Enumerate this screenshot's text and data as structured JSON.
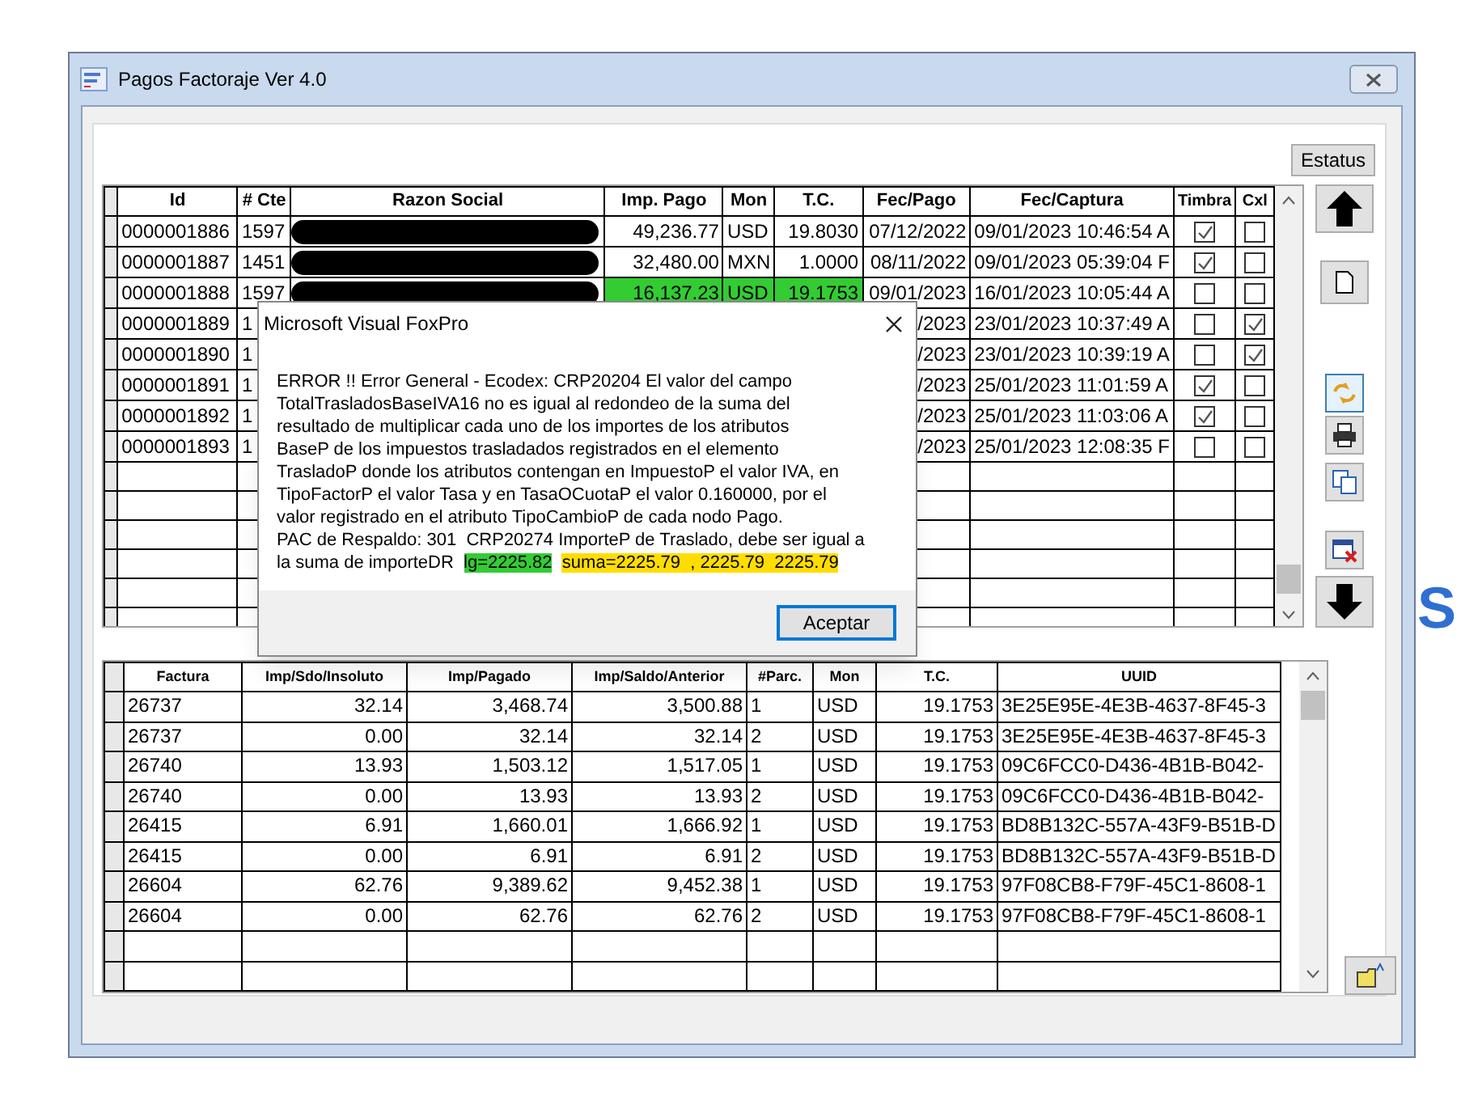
{
  "window": {
    "title": "Pagos Factoraje Ver 4.0"
  },
  "estatus_button": "Estatus",
  "payments": {
    "columns": [
      "Id",
      "# Cte",
      "Razon Social",
      "Imp. Pago",
      "Mon",
      "T.C.",
      "Fec/Pago",
      "Fec/Captura",
      "Timbra",
      "Cxl"
    ],
    "rows": [
      {
        "id": "0000001886",
        "cte": "1597",
        "imp_pago": "49,236.77",
        "mon": "USD",
        "tc": "19.8030",
        "fec_pago": "07/12/2022",
        "fec_captura": "09/01/2023 10:46:54 A",
        "timbra": true,
        "cxl": false,
        "highlighted": false,
        "redacted": true
      },
      {
        "id": "0000001887",
        "cte": "1451",
        "imp_pago": "32,480.00",
        "mon": "MXN",
        "tc": "1.0000",
        "fec_pago": "08/11/2022",
        "fec_captura": "09/01/2023 05:39:04 F",
        "timbra": true,
        "cxl": false,
        "highlighted": false,
        "redacted": true
      },
      {
        "id": "0000001888",
        "cte": "1597",
        "imp_pago": "16,137.23",
        "mon": "USD",
        "tc": "19.1753",
        "fec_pago": "09/01/2023",
        "fec_captura": "16/01/2023 10:05:44 A",
        "timbra": false,
        "cxl": false,
        "highlighted": true,
        "redacted": true
      },
      {
        "id": "0000001889",
        "cte": "1",
        "fec_pago": "/2023",
        "fec_captura": "23/01/2023 10:37:49 A",
        "timbra": false,
        "cxl": true
      },
      {
        "id": "0000001890",
        "cte": "1",
        "fec_pago": "/2023",
        "fec_captura": "23/01/2023 10:39:19 A",
        "timbra": false,
        "cxl": true
      },
      {
        "id": "0000001891",
        "cte": "1",
        "fec_pago": "/2023",
        "fec_captura": "25/01/2023 11:01:59 A",
        "timbra": true,
        "cxl": false
      },
      {
        "id": "0000001892",
        "cte": "1",
        "fec_pago": "/2023",
        "fec_captura": "25/01/2023 11:03:06 A",
        "timbra": true,
        "cxl": false
      },
      {
        "id": "0000001893",
        "cte": "1",
        "fec_pago": "/2023",
        "fec_captura": "25/01/2023 12:08:35 F",
        "timbra": false,
        "cxl": false
      }
    ]
  },
  "details": {
    "columns": [
      "Factura",
      "Imp/Sdo/Insoluto",
      "Imp/Pagado",
      "Imp/Saldo/Anterior",
      "#Parc.",
      "Mon",
      "T.C.",
      "UUID"
    ],
    "rows": [
      [
        "26737",
        "32.14",
        "3,468.74",
        "3,500.88",
        "1",
        "USD",
        "19.1753",
        "3E25E95E-4E3B-4637-8F45-3"
      ],
      [
        "26737",
        "0.00",
        "32.14",
        "32.14",
        "2",
        "USD",
        "19.1753",
        "3E25E95E-4E3B-4637-8F45-3"
      ],
      [
        "26740",
        "13.93",
        "1,503.12",
        "1,517.05",
        "1",
        "USD",
        "19.1753",
        "09C6FCC0-D436-4B1B-B042-"
      ],
      [
        "26740",
        "0.00",
        "13.93",
        "13.93",
        "2",
        "USD",
        "19.1753",
        "09C6FCC0-D436-4B1B-B042-"
      ],
      [
        "26415",
        "6.91",
        "1,660.01",
        "1,666.92",
        "1",
        "USD",
        "19.1753",
        "BD8B132C-557A-43F9-B51B-D"
      ],
      [
        "26415",
        "0.00",
        "6.91",
        "6.91",
        "2",
        "USD",
        "19.1753",
        "BD8B132C-557A-43F9-B51B-D"
      ],
      [
        "26604",
        "62.76",
        "9,389.62",
        "9,452.38",
        "1",
        "USD",
        "19.1753",
        "97F08CB8-F79F-45C1-8608-1"
      ],
      [
        "26604",
        "0.00",
        "62.76",
        "62.76",
        "2",
        "USD",
        "19.1753",
        "97F08CB8-F79F-45C1-8608-1"
      ]
    ]
  },
  "dialog": {
    "title": "Microsoft Visual FoxPro",
    "lines": [
      "ERROR !! Error General - Ecodex: CRP20204 El valor del campo",
      "TotalTrasladosBaseIVA16 no es igual al redondeo de la suma del",
      "resultado de multiplicar cada uno de los importes de los atributos",
      "BaseP de los impuestos trasladados registrados en el elemento",
      "TrasladoP donde los atributos contengan en ImpuestoP el valor IVA, en",
      "TipoFactorP el valor Tasa y en TasaOCuotaP el valor 0.160000, por el",
      "valor registrado en el atributo TipoCambioP de cada nodo Pago.",
      "PAC de Respaldo: 301  CRP20274 ImporteP de Traslado, debe ser igual a"
    ],
    "last_line": "la suma de importeDR",
    "highlights": [
      {
        "text": "lg=2225.82",
        "color": "#33cc33"
      },
      {
        "text": "suma=2225.79  , 2225.79  2225.79",
        "color": "#ffdd00"
      }
    ],
    "button": "Aceptar"
  },
  "background_text": "S"
}
